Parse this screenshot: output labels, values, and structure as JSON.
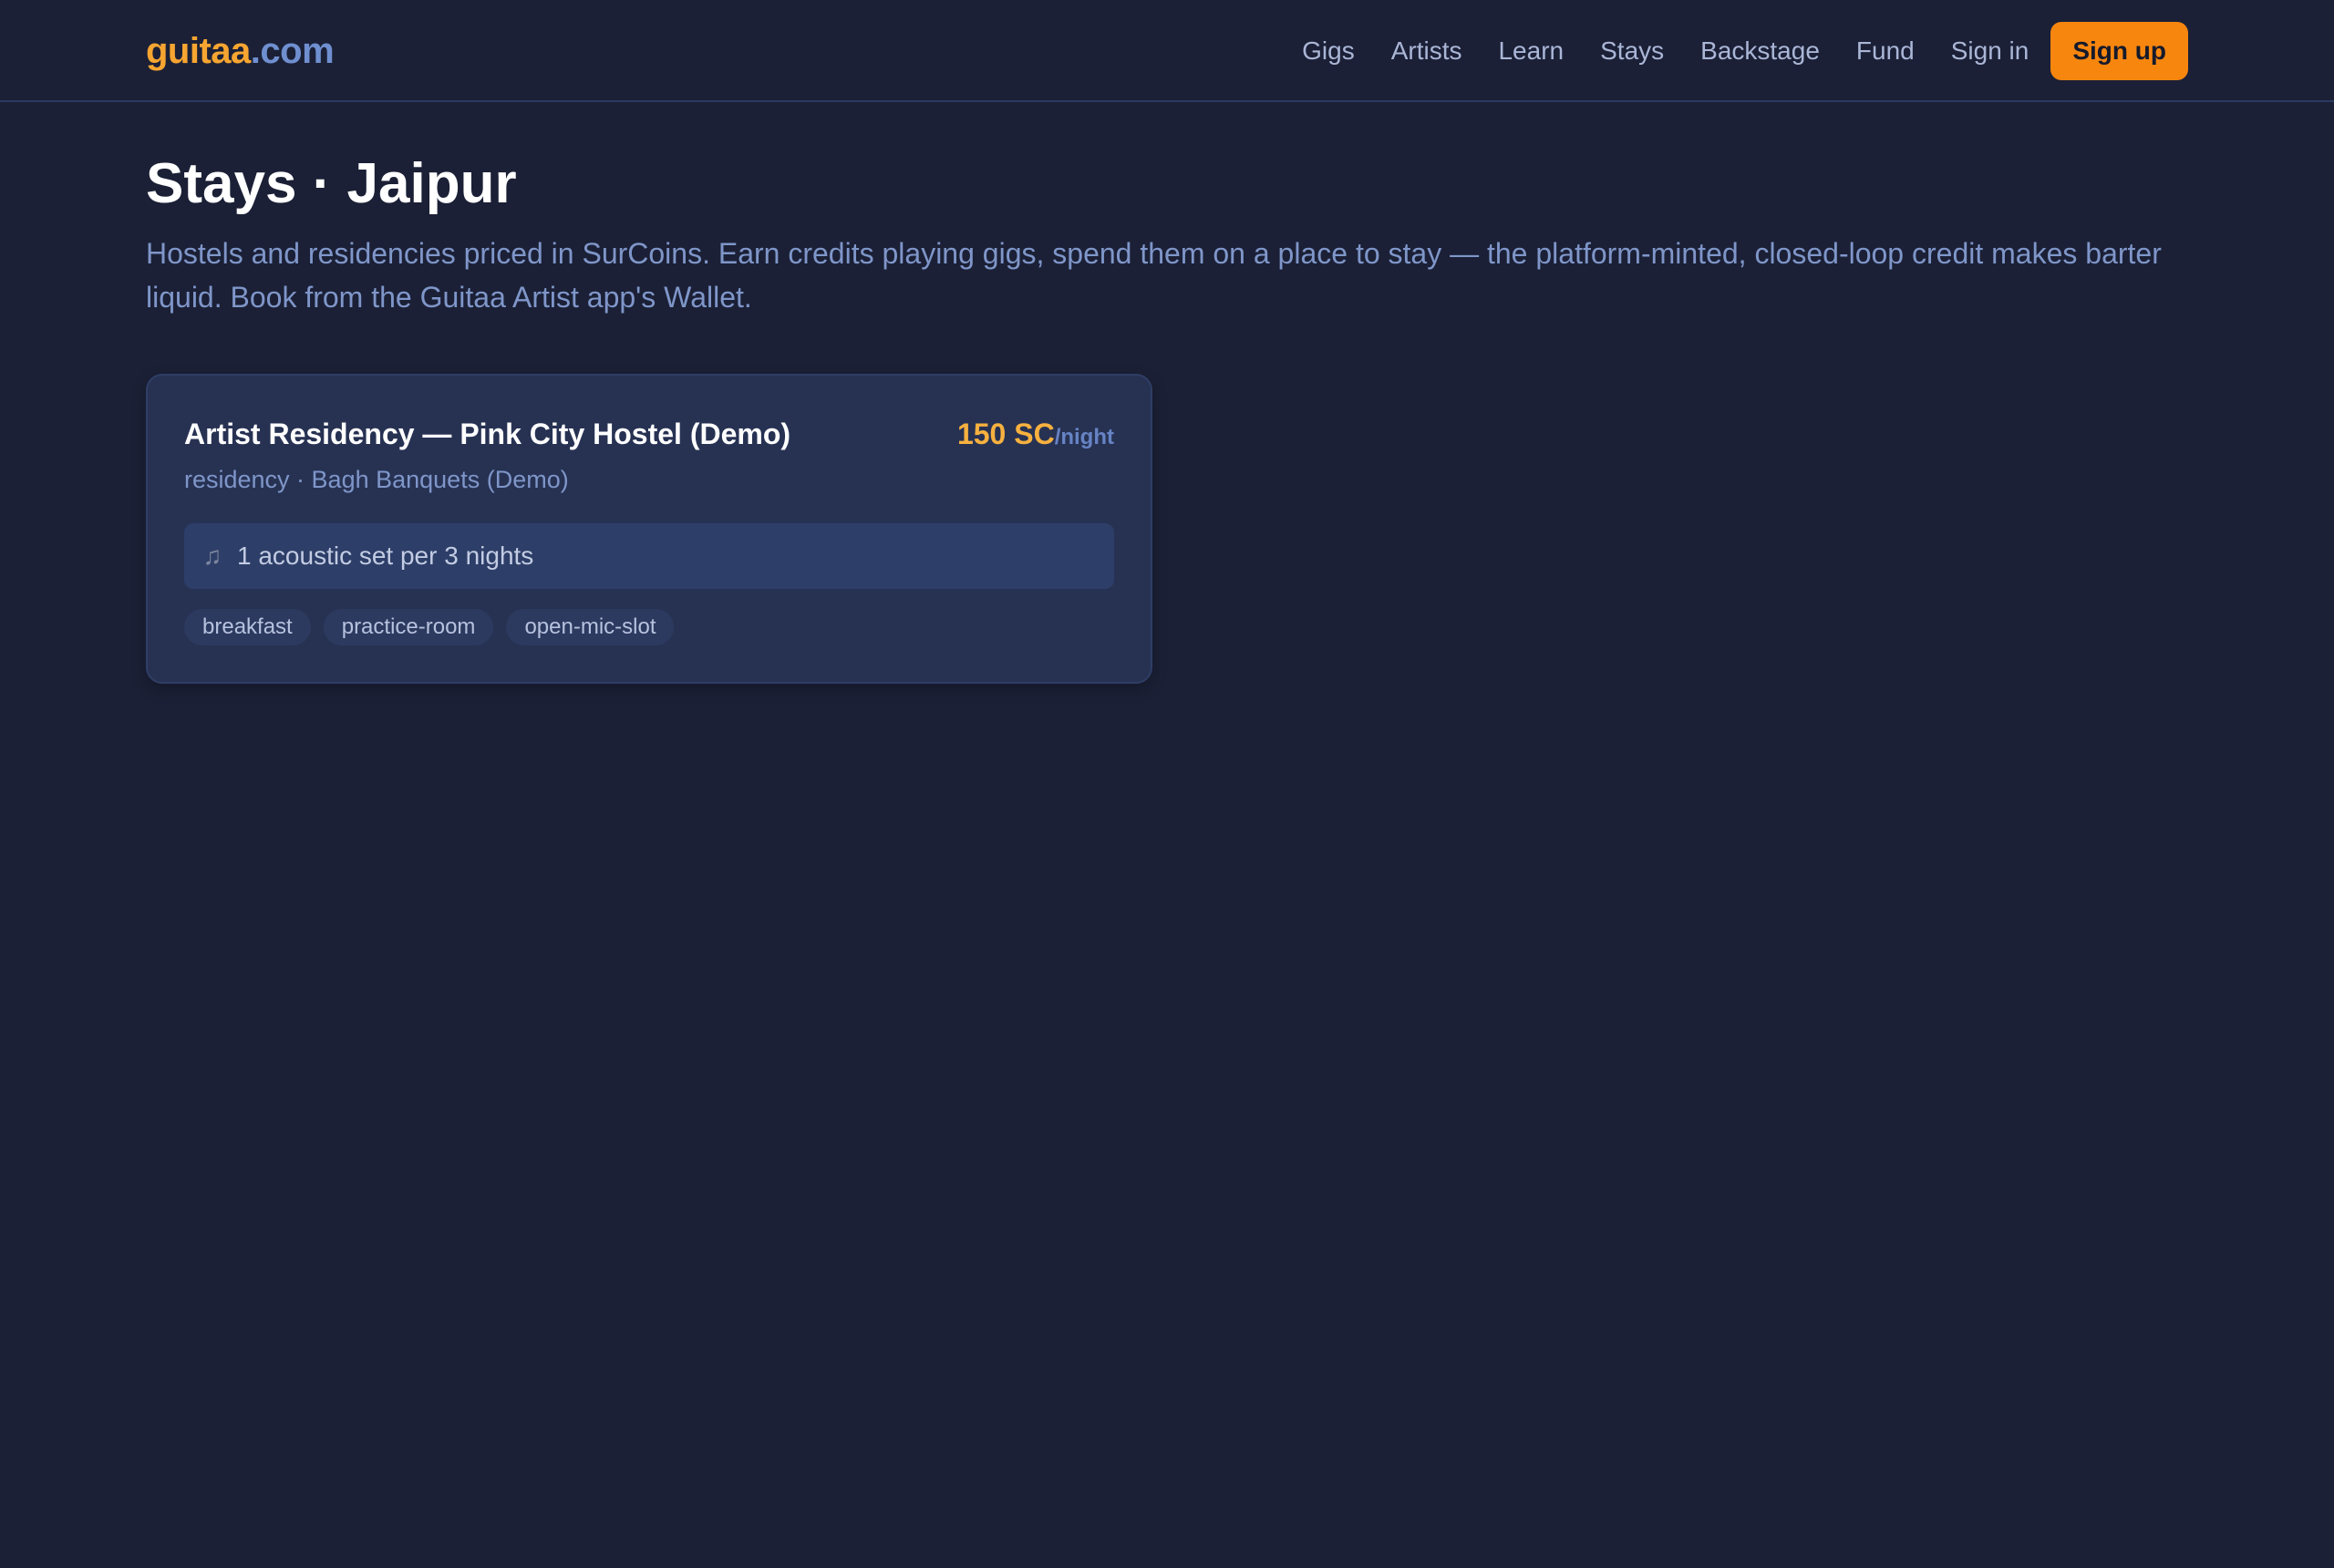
{
  "header": {
    "brand_main": "guitaa",
    "brand_tld": ".com",
    "nav": [
      "Gigs",
      "Artists",
      "Learn",
      "Stays",
      "Backstage",
      "Fund",
      "Sign in"
    ],
    "signup_label": "Sign up"
  },
  "page": {
    "title": "Stays · Jaipur",
    "description": "Hostels and residencies priced in SurCoins. Earn credits playing gigs, spend them on a place to stay — the platform-minted, closed-loop credit makes barter liquid. Book from the Guitaa Artist app's Wallet."
  },
  "listings": [
    {
      "title": "Artist Residency — Pink City Hostel (Demo)",
      "price": "150 SC",
      "price_unit": "/night",
      "subtitle": "residency · Bagh Banquets (Demo)",
      "terms_icon": "music-note-icon",
      "terms": "1 acoustic set per 3 nights",
      "tags": [
        "breakfast",
        "practice-room",
        "open-mic-slot"
      ]
    }
  ],
  "colors": {
    "background": "#1b2036",
    "accent": "#f7860f",
    "price": "#f7b13f",
    "brand_tld": "#6f8fd0",
    "muted_text": "#7f96c9",
    "card": "#273253"
  }
}
